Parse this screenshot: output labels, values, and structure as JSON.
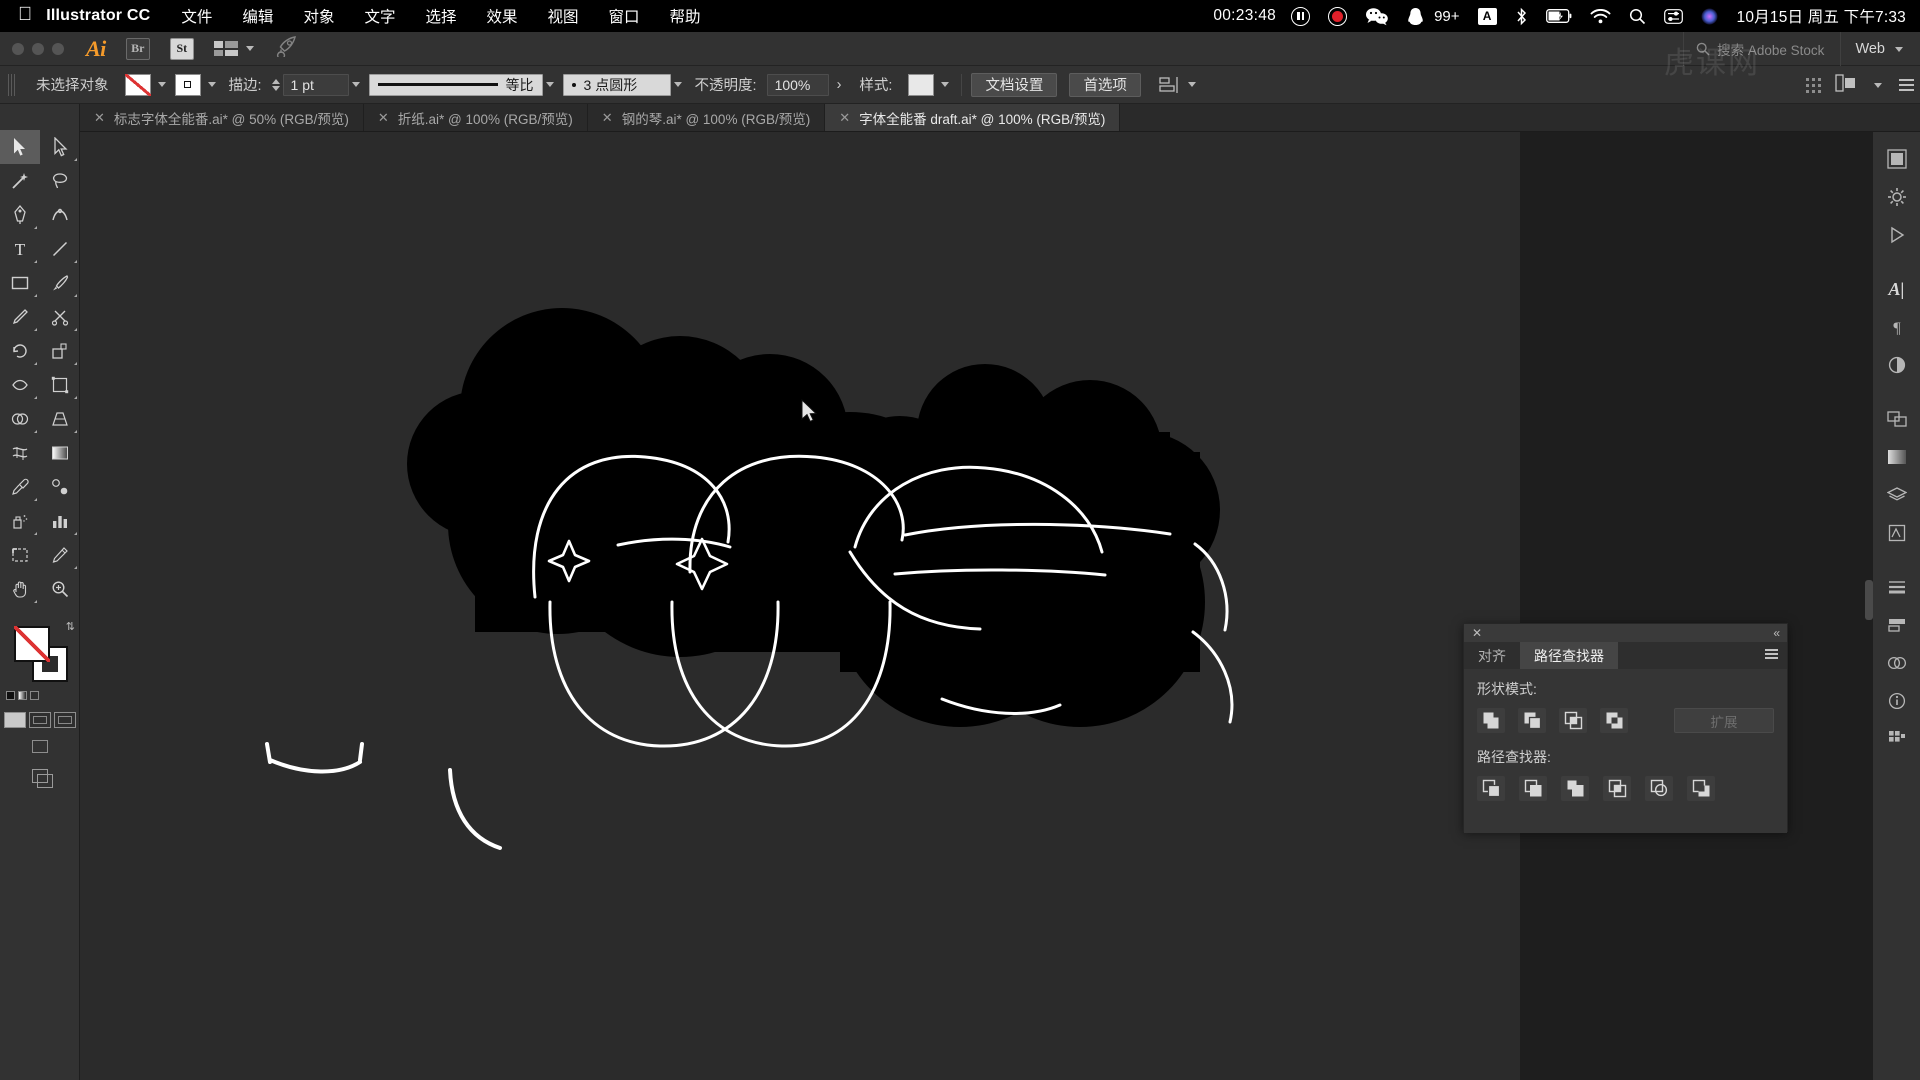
{
  "macbar": {
    "apple_icon": "apple-icon",
    "app_name": "Illustrator CC",
    "menus": [
      "文件",
      "编辑",
      "对象",
      "文字",
      "选择",
      "效果",
      "视图",
      "窗口",
      "帮助"
    ],
    "recording_time": "00:23:48",
    "pause_icon": "pause-icon",
    "record_icon": "record-icon",
    "wechat_icon": "wechat-icon",
    "qq_icon": "qq-icon",
    "notification_count": "99+",
    "input_method": "A",
    "bluetooth_icon": "bluetooth-icon",
    "battery_icon": "battery-icon",
    "wifi_icon": "wifi-icon",
    "spotlight_icon": "search-icon",
    "controlcenter_icon": "control-center-icon",
    "siri_icon": "siri-icon",
    "datetime": "10月15日 周五 下午7:33"
  },
  "appbar": {
    "logo": "Ai",
    "bridge_label": "Br",
    "stock_label": "St",
    "arrange_icon": "arrange-documents-icon",
    "workspace_chevron": "chevron-down-icon",
    "rocket_icon": "rocket-icon",
    "workspace_label": "Web",
    "search_icon": "search-icon",
    "search_placeholder": "搜索 Adobe Stock"
  },
  "controlbar": {
    "selection_status": "未选择对象",
    "fill_swatch": "fill-none-swatch",
    "stroke_swatch": "stroke-swatch",
    "stroke_label": "描边:",
    "stroke_weight": "1 pt",
    "stroke_profile": "等比",
    "brush_definition": "3 点圆形",
    "opacity_label": "不透明度:",
    "opacity_value": "100%",
    "style_label": "样式:",
    "document_setup": "文档设置",
    "preferences": "首选项",
    "align_icon": "align-icon",
    "grid_icon": "grid-icon",
    "panel_menu_icon": "hamburger-icon"
  },
  "tabs": [
    {
      "title": "标志字体全能番.ai* @ 50% (RGB/预览)",
      "active": false
    },
    {
      "title": "折纸.ai* @ 100% (RGB/预览)",
      "active": false
    },
    {
      "title": "钢的琴.ai* @ 100% (RGB/预览)",
      "active": false
    },
    {
      "title": "字体全能番 draft.ai* @ 100% (RGB/预览)",
      "active": true
    }
  ],
  "toolbar": {
    "tools": [
      "selection-tool",
      "direct-selection-tool",
      "magic-wand-tool",
      "lasso-tool",
      "pen-tool",
      "curvature-tool",
      "type-tool",
      "line-segment-tool",
      "rectangle-tool",
      "paintbrush-tool",
      "pencil-tool",
      "scissors-tool",
      "rotate-tool",
      "scale-tool",
      "width-tool",
      "free-transform-tool",
      "shape-builder-tool",
      "perspective-grid-tool",
      "mesh-tool",
      "gradient-tool",
      "eyedropper-tool",
      "blend-tool",
      "symbol-sprayer-tool",
      "column-graph-tool",
      "artboard-tool",
      "slice-tool",
      "hand-tool",
      "zoom-tool"
    ],
    "fill_swatch": "fill-none-swatch",
    "stroke_swatch": "stroke-swatch",
    "swap_icon": "swap-fill-stroke-icon",
    "draw_modes": [
      "draw-normal-mode",
      "draw-behind-mode",
      "draw-inside-mode"
    ],
    "screen_modes": [
      "screen-mode-icon"
    ]
  },
  "rightrail": {
    "items": [
      "color-panel-icon",
      "gear-icon",
      "play-icon",
      "type-panel-icon",
      "paragraph-panel-icon",
      "transparency-panel-icon",
      "artboards-panel-icon",
      "gradient-panel-icon",
      "layers-panel-icon",
      "symbols-panel-icon",
      "brushes-panel-icon",
      "align-panel-icon",
      "appearance-panel-icon",
      "image-trace-panel-icon",
      "info-panel-icon",
      "libraries-panel-icon"
    ]
  },
  "pathfinder_panel": {
    "close_icon": "close-icon",
    "collapse_icon": "collapse-panel-icon",
    "menu_icon": "panel-menu-icon",
    "tabs": [
      {
        "label": "对齐",
        "active": false
      },
      {
        "label": "路径查找器",
        "active": true
      }
    ],
    "shape_modes_label": "形状模式:",
    "shape_modes": [
      "unite-icon",
      "minus-front-icon",
      "intersect-icon",
      "exclude-icon"
    ],
    "expand_button": "扩展",
    "pathfinders_label": "路径查找器:",
    "pathfinders": [
      "divide-icon",
      "trim-icon",
      "merge-icon",
      "crop-icon",
      "outline-icon",
      "minus-back-icon"
    ]
  },
  "canvas": {
    "artwork_name": "blobby-lettering-artwork",
    "cursor": "arrow-cursor",
    "background_color": "#2b2b2b",
    "artwork_fill": "#000000",
    "artwork_stroke": "#ffffff"
  },
  "watermark": "虎课网"
}
